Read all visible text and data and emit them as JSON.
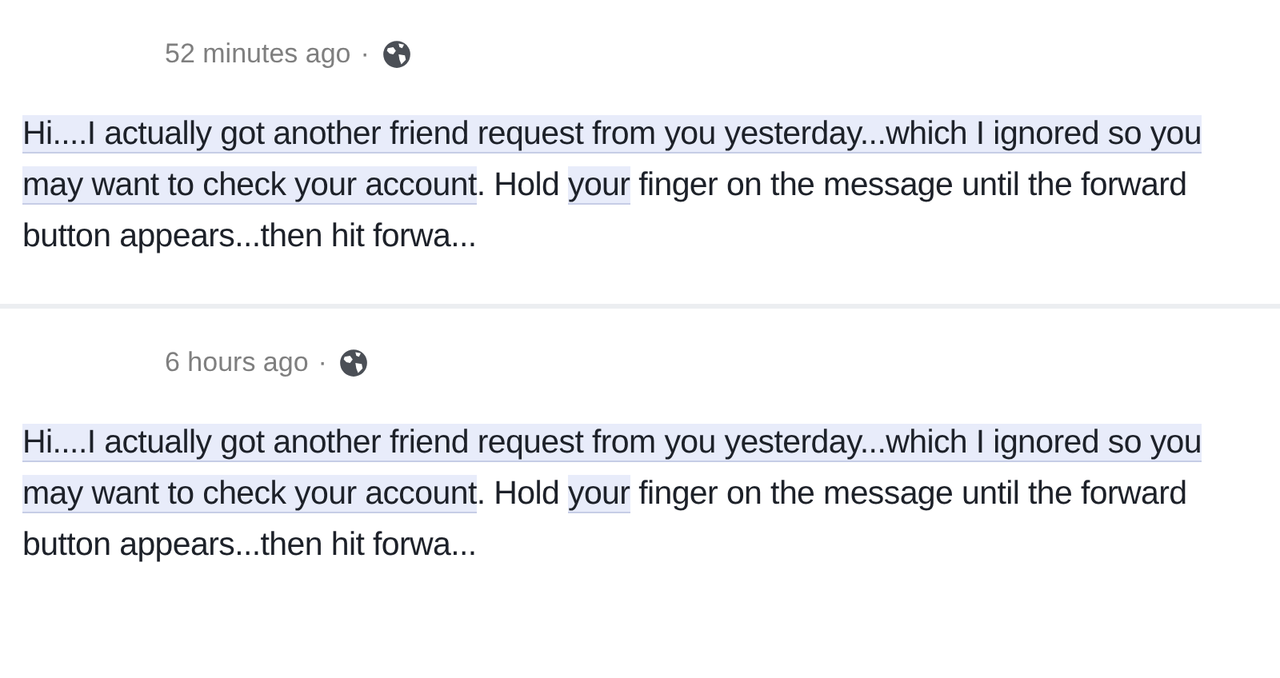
{
  "posts": [
    {
      "time": "52 minutes ago",
      "separator": "·",
      "body": [
        {
          "text": "Hi....I actually got another friend request from you yesterday...which I ignored so you may want to check your account",
          "highlighted": true
        },
        {
          "text": ". Hold ",
          "highlighted": false
        },
        {
          "text": "your",
          "highlighted": true
        },
        {
          "text": " finger on the message until the forward button appears...then hit forwa...",
          "highlighted": false
        }
      ]
    },
    {
      "time": "6 hours ago",
      "separator": "·",
      "body": [
        {
          "text": "Hi....I actually got another friend request from you yesterday...which I ignored so you may want to check your account",
          "highlighted": true
        },
        {
          "text": ". Hold ",
          "highlighted": false
        },
        {
          "text": "your",
          "highlighted": true
        },
        {
          "text": " finger on the message until the forward button appears...then hit forwa...",
          "highlighted": false
        }
      ]
    }
  ]
}
